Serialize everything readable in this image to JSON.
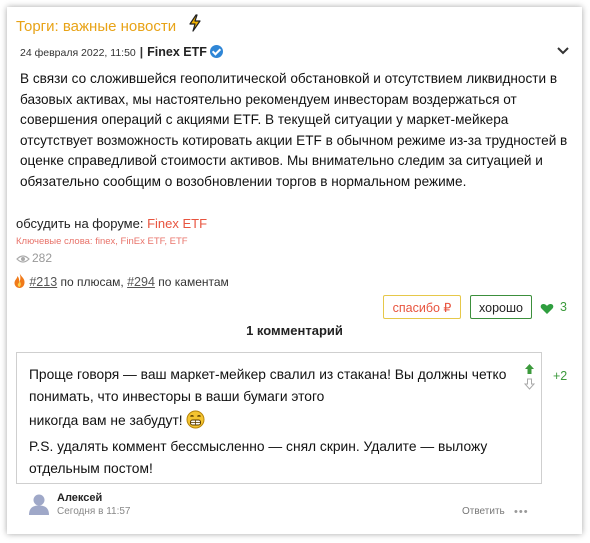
{
  "post": {
    "title": "Торги: важные новости",
    "date": "24 февраля 2022, 11:50",
    "separator": "|",
    "author": "Finex ETF",
    "body": "В связи со сложившейся геополитической обстановкой и отсутствием ликвидности в базовых активах, мы настоятельно рекомендуем инвесторам воздержаться от совершения операций с акциями ETF. В текущей ситуации у маркет-мейкера отсутствует возможность котировать акции ETF в обычном режиме из-за трудностей в оценке справедливой стоимости активов. Мы внимательно следим за ситуацией и обязательно сообщим о возобновлении торгов в нормальном режиме.",
    "forum_prefix": "обсудить на форуме:",
    "forum_link": "Finex ETF",
    "keywords": "Ключевые слова: finex, FinEx ETF, ETF",
    "views": "282",
    "rank_plus": "#213",
    "rank_plus_label": "по плюсам,",
    "rank_comments": "#294",
    "rank_comments_label": "по каментам"
  },
  "actions": {
    "thanks_label": "спасибо ₽",
    "good_label": "хорошо",
    "likes": "3"
  },
  "comments_header": "1 комментарий",
  "comment": {
    "line1": "Проще говоря — ваш маркет-мейкер свалил из стакана! Вы должны четко понимать, что инвесторы в ваши бумаги этого",
    "line2": "никогда вам не забудут!",
    "line3": "P.S. удалять коммент бессмысленно — снял скрин. Удалите — выложу отдельным постом!",
    "score": "+2",
    "author": "Алексей",
    "time": "Сегодня в 11:57",
    "reply_label": "Ответить",
    "more": "•••"
  },
  "colors": {
    "title": "#e8a317",
    "link": "#e8543f",
    "positive": "#3c9a3c",
    "verified": "#2f86d6"
  },
  "icons": [
    "lightning-icon",
    "verified-icon",
    "chevron-down-icon",
    "eye-icon",
    "fire-icon",
    "heart-icon",
    "arrow-up-icon",
    "arrow-down-icon",
    "grin-emoji-icon",
    "avatar-icon"
  ]
}
